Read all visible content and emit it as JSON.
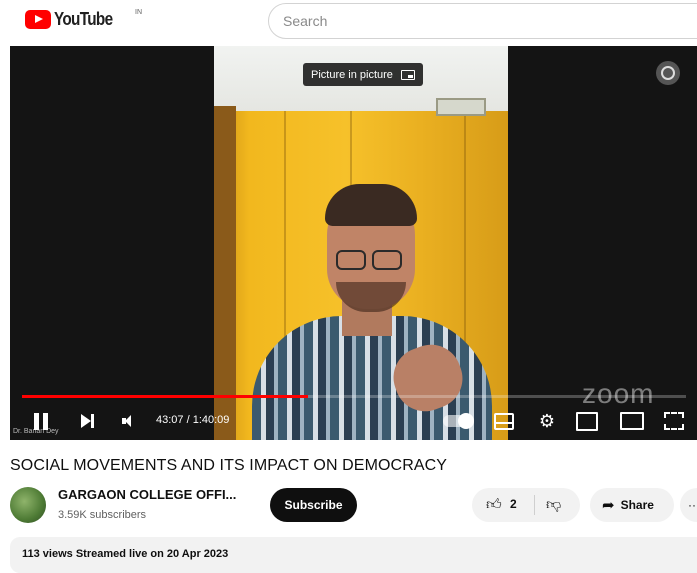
{
  "header": {
    "logo_text": "YouTube",
    "country_code": "IN",
    "search_placeholder": "Search"
  },
  "player": {
    "tooltip": "Picture in picture",
    "watermark": "zoom",
    "presenter_label": "Dr. Banan Dey",
    "time_display": "43:07 / 1:40:09",
    "progress_fraction": 0.43,
    "accent_color": "#ff0000",
    "icons": [
      "pause-icon",
      "next-icon",
      "volume-icon",
      "autoplay-toggle",
      "cc-icon",
      "settings-icon",
      "miniplayer-icon",
      "theater-icon",
      "fullscreen-icon",
      "ambient-icon"
    ]
  },
  "video": {
    "title": "SOCIAL MOVEMENTS AND ITS IMPACT ON DEMOCRACY"
  },
  "channel": {
    "name": "GARGAON COLLEGE OFFI...",
    "subscribers": "3.59K subscribers",
    "subscribe_label": "Subscribe"
  },
  "actions": {
    "like_count": "2",
    "share_label": "Share",
    "more_label": "···"
  },
  "description": {
    "meta": "113 views  Streamed live on 20 Apr 2023"
  }
}
